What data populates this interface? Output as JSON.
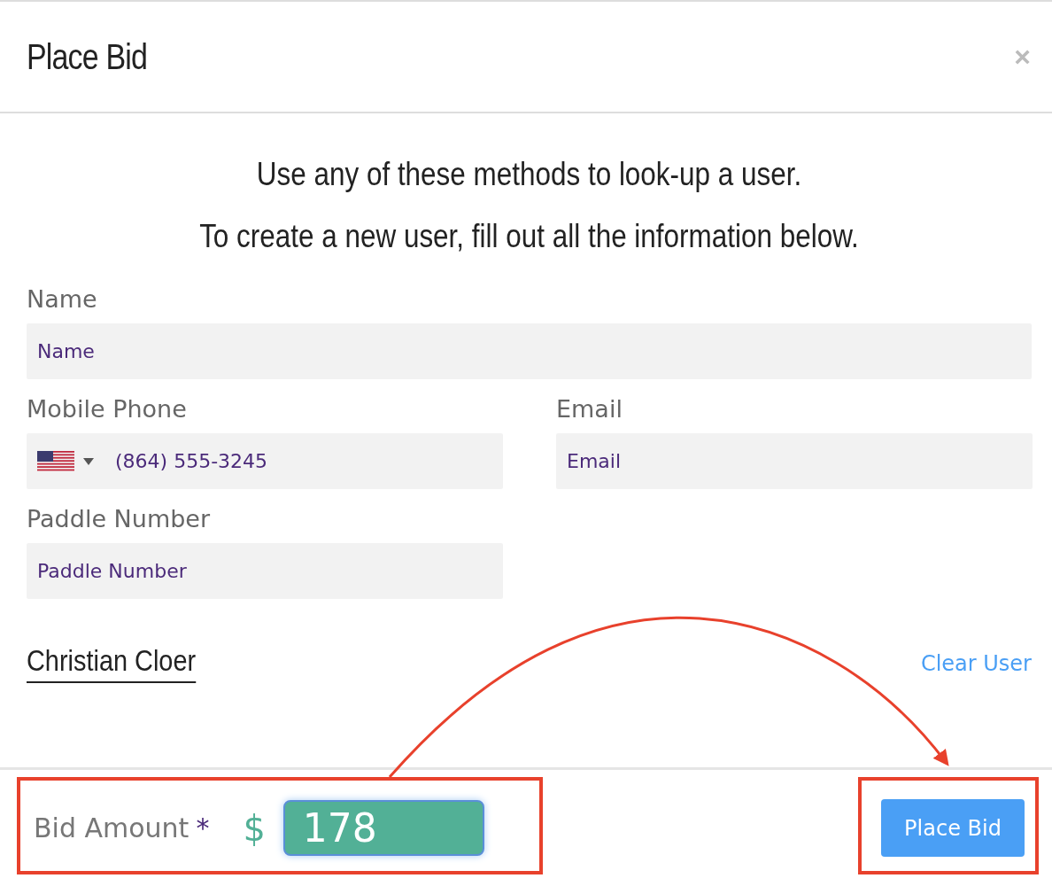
{
  "dialog": {
    "title": "Place Bid",
    "close": "×"
  },
  "intro": [
    "Use any of these methods to look-up a user.",
    "To create a new user, fill out all the information below."
  ],
  "fields": {
    "name": {
      "label": "Name",
      "placeholder": "Name"
    },
    "phone": {
      "label": "Mobile Phone",
      "value": "(864) 555-3245"
    },
    "email": {
      "label": "Email",
      "placeholder": "Email"
    },
    "paddle": {
      "label": "Paddle Number",
      "placeholder": "Paddle Number"
    }
  },
  "user": {
    "name": "Christian Cloer",
    "clear": "Clear User"
  },
  "footer": {
    "bid_label": "Bid Amount",
    "required": "*",
    "currency": "$",
    "bid_value": "178",
    "submit": "Place Bid"
  }
}
